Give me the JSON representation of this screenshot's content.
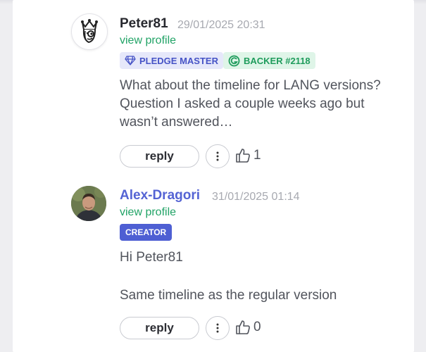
{
  "comments": [
    {
      "author": "Peter81",
      "date": "29/01/2025 20:31",
      "view_profile": "view profile",
      "badges": [
        "PLEDGE MASTER",
        "BACKER #2118"
      ],
      "text_lines": [
        "What about the timeline for LANG versions?",
        "Question I asked a couple weeks ago but",
        "wasn’t answered…"
      ],
      "reply_label": "reply",
      "likes": "1",
      "avatar_icon": "king-mascot-icon"
    },
    {
      "author": "Alex-Dragori",
      "date": "31/01/2025 01:14",
      "view_profile": "view profile",
      "badges": [
        "CREATOR"
      ],
      "text_lines": [
        "Hi Peter81",
        "Same timeline as the regular version"
      ],
      "reply_label": "reply",
      "likes": "0",
      "avatar_icon": "user-photo"
    }
  ],
  "colors": {
    "creator_name": "#5463d4",
    "profile_link": "#21a366",
    "pledge_badge_bg": "#e6e8fa",
    "backer_badge_bg": "#dff5e8",
    "creator_badge_bg": "#4e5fd3"
  }
}
